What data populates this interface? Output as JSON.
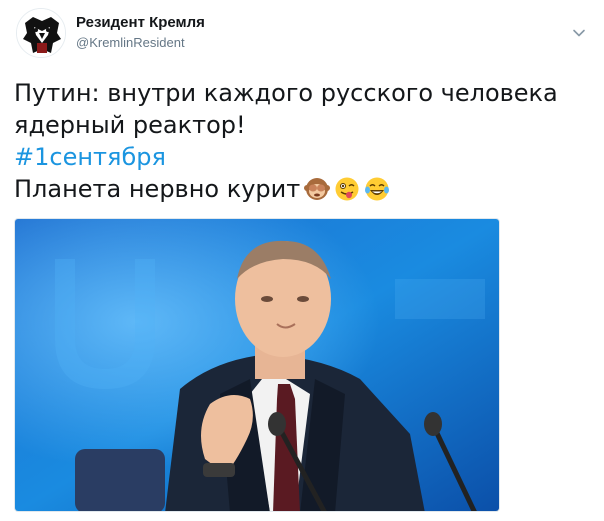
{
  "tweet": {
    "author": {
      "display_name": "Резидент Кремля",
      "handle": "@KremlinResident"
    },
    "menu_icon": "chevron-down-icon",
    "lines": {
      "line1": "Путин: внутри каждого русского человека",
      "line2": "ядерный реактор!",
      "hashtag": "#1сентября",
      "line4": "Планета нервно курит"
    },
    "emojis": [
      "see-no-evil-monkey-emoji",
      "winking-tongue-emoji",
      "tears-of-joy-emoji"
    ],
    "media": {
      "description_icon": "photo"
    }
  },
  "colors": {
    "hashtag": "#1b95e0",
    "handle": "#657786",
    "text": "#14171a"
  }
}
